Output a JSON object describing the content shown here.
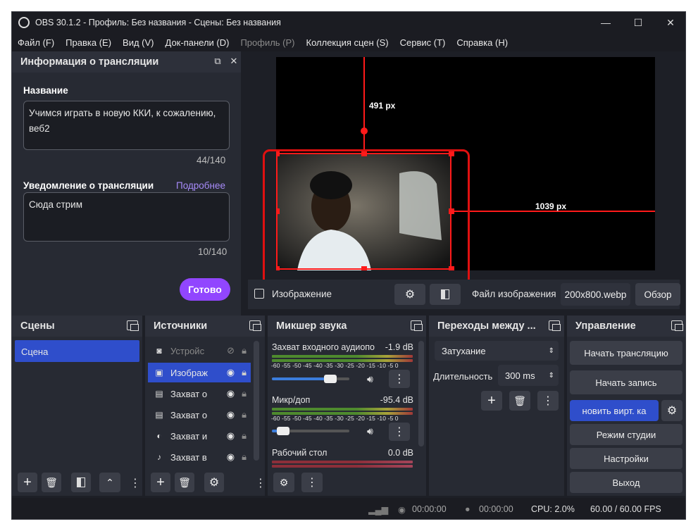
{
  "window": {
    "title": "OBS 30.1.2 - Профиль: Без названия - Сцены: Без названия",
    "minimize": "—",
    "maximize": "☐",
    "close": "✕"
  },
  "menu": [
    {
      "label": "Файл (F)",
      "disabled": false
    },
    {
      "label": "Правка (E)",
      "disabled": false
    },
    {
      "label": "Вид (V)",
      "disabled": false
    },
    {
      "label": "Док-панели (D)",
      "disabled": false
    },
    {
      "label": "Профиль (P)",
      "disabled": true
    },
    {
      "label": "Коллекция сцен (S)",
      "disabled": false
    },
    {
      "label": "Сервис (T)",
      "disabled": false
    },
    {
      "label": "Справка (H)",
      "disabled": false
    }
  ],
  "stream_info": {
    "title": "Информация о трансляции",
    "name_label": "Название",
    "name_value": "Учимся играть в новую ККИ, к сожалению, веб2",
    "name_count": "44/140",
    "notify_label": "Уведомление о трансляции",
    "more_link": "Подробнее",
    "notify_value": "Сюда стрим",
    "notify_count": "10/140",
    "done_button": "Готово"
  },
  "preview": {
    "top_dist": "491 px",
    "right_dist": "1039 px"
  },
  "source_toolbar": {
    "source_name": "Изображение",
    "file_label": "Файл изображения",
    "file_value": "200x800.webp",
    "browse": "Обзор"
  },
  "scenes": {
    "title": "Сцены",
    "items": [
      "Сцена"
    ]
  },
  "sources": {
    "title": "Источники",
    "items": [
      {
        "label": "Устройс",
        "icon": "camera-icon",
        "hidden": true,
        "selected": false
      },
      {
        "label": "Изображ",
        "icon": "image-icon",
        "hidden": false,
        "selected": true
      },
      {
        "label": "Захват о",
        "icon": "window-icon",
        "hidden": false,
        "selected": false
      },
      {
        "label": "Захват о",
        "icon": "window-icon",
        "hidden": false,
        "selected": false
      },
      {
        "label": "Захват и",
        "icon": "gamepad-icon",
        "hidden": false,
        "selected": false
      },
      {
        "label": "Захват в",
        "icon": "mic-icon",
        "hidden": false,
        "selected": false
      }
    ]
  },
  "mixer": {
    "title": "Микшер звука",
    "ticks": "-60 -55 -50 -45 -40 -35 -30 -25 -20 -15 -10 -5 0",
    "channels": [
      {
        "name": "Захват входного аудиопо",
        "db": "-1.9 dB",
        "volume": 0.8
      },
      {
        "name": "Микр/доп",
        "db": "-95.4 dB",
        "volume": 0.08
      },
      {
        "name": "Рабочий стол",
        "db": "0.0 dB",
        "volume": 0
      }
    ]
  },
  "transitions": {
    "title": "Переходы между ...",
    "type": "Затухание",
    "duration_label": "Длительность",
    "duration": "300 ms"
  },
  "controls": {
    "title": "Управление",
    "buttons": [
      "Начать трансляцию",
      "Начать запись",
      "новить вирт. ка",
      "Режим студии",
      "Настройки",
      "Выход"
    ]
  },
  "status": {
    "rec_time": "00:00:00",
    "stream_time": "00:00:00",
    "cpu": "CPU: 2.0%",
    "fps": "60.00 / 60.00 FPS"
  },
  "colors": {
    "accent": "#2f4ecb",
    "done": "#9146ff",
    "selection": "#ff0000"
  }
}
